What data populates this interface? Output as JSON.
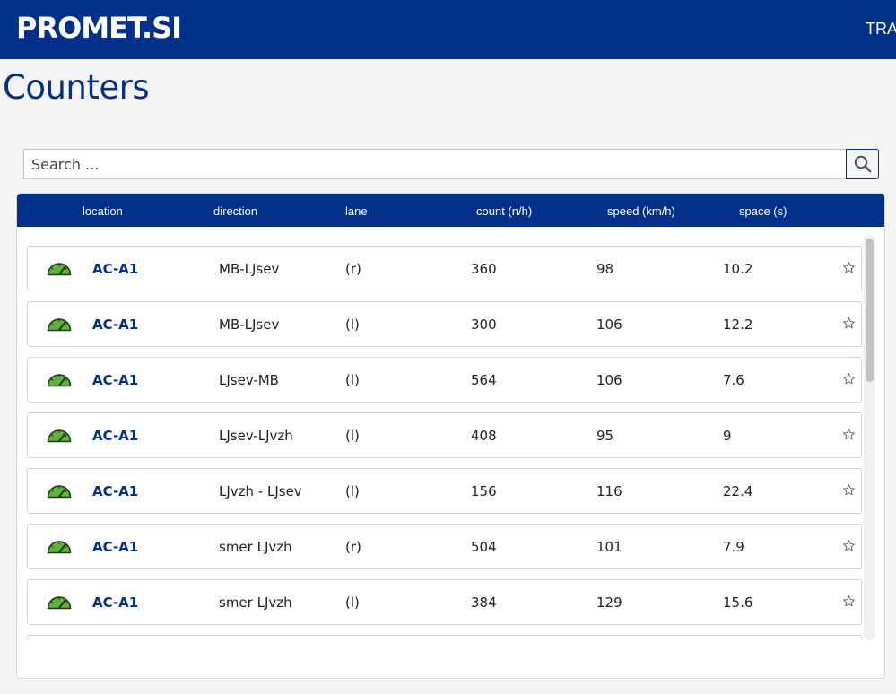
{
  "header": {
    "logo": "PROMET.SI",
    "nav_partial": "TRA",
    "bg_color": "#003087"
  },
  "page": {
    "title": "Counters"
  },
  "search": {
    "placeholder": "Search ...",
    "icon": "search-icon"
  },
  "table": {
    "columns": [
      "location",
      "direction",
      "lane",
      "count (n/h)",
      "speed (km/h)",
      "space (s)"
    ],
    "rows": [
      {
        "location": "AC-A1",
        "direction": "MB-LJsev",
        "lane": "(r)",
        "count": "360",
        "speed": "98",
        "space": "10.2"
      },
      {
        "location": "AC-A1",
        "direction": "MB-LJsev",
        "lane": "(l)",
        "count": "300",
        "speed": "106",
        "space": "12.2"
      },
      {
        "location": "AC-A1",
        "direction": "LJsev-MB",
        "lane": "(l)",
        "count": "564",
        "speed": "106",
        "space": "7.6"
      },
      {
        "location": "AC-A1",
        "direction": "LJsev-LJvzh",
        "lane": "(l)",
        "count": "408",
        "speed": "95",
        "space": "9"
      },
      {
        "location": "AC-A1",
        "direction": "LJvzh - LJsev",
        "lane": "(l)",
        "count": "156",
        "speed": "116",
        "space": "22.4"
      },
      {
        "location": "AC-A1",
        "direction": "smer LJvzh",
        "lane": "(r)",
        "count": "504",
        "speed": "101",
        "space": "7.9"
      },
      {
        "location": "AC-A1",
        "direction": "smer LJvzh",
        "lane": "(l)",
        "count": "384",
        "speed": "129",
        "space": "15.6"
      }
    ],
    "row_icon": "speedometer-icon",
    "favorite_icon": "star-outline-icon",
    "gauge_color": "#5fb336"
  }
}
